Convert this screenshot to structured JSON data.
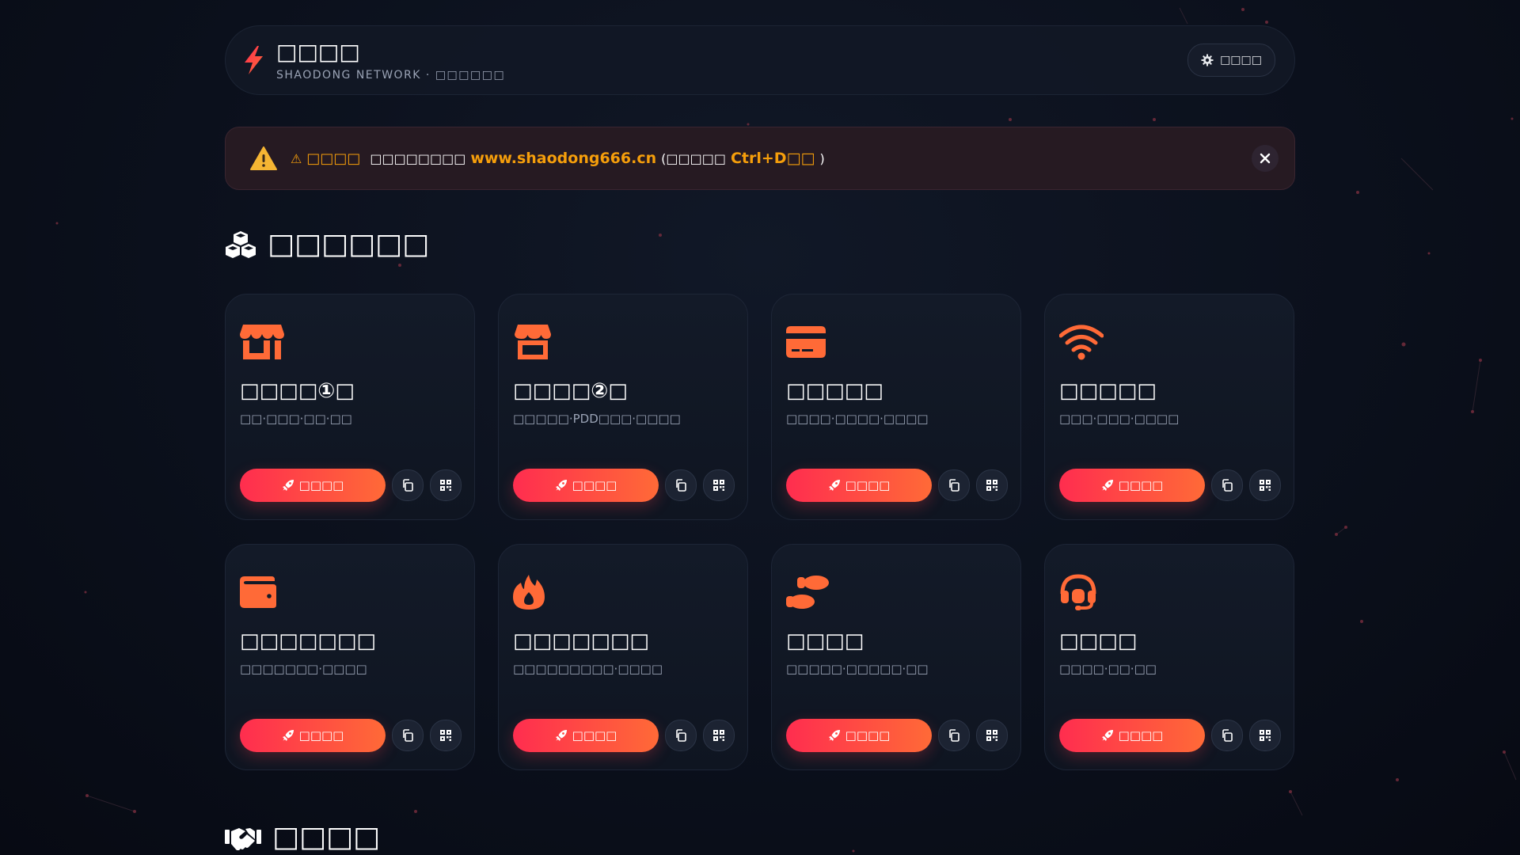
{
  "header": {
    "title": "□□□□",
    "subtitle": "SHAODONG NETWORK · □□□□□□",
    "settings_label": "□□□□"
  },
  "notice": {
    "label": "□□□□",
    "message": "□□□□□□□□",
    "url": "www.shaodong666.cn",
    "paren_open": "(□□□□□",
    "shortcut": "Ctrl+D□□",
    "paren_close": ")"
  },
  "sections": {
    "tools_title": "□□□□□□",
    "partners_title": "□□□□"
  },
  "cards": [
    {
      "icon": "store-icon",
      "title": "□□□□①□",
      "desc": "□□·□□□·□□·□□",
      "button": "□□□□"
    },
    {
      "icon": "shop-icon",
      "title": "□□□□②□",
      "desc": "□□□□□·PDD□□□·□□□□",
      "button": "□□□□"
    },
    {
      "icon": "credit-card-icon",
      "title": "□□□□□",
      "desc": "□□□□·□□□□·□□□□",
      "button": "□□□□"
    },
    {
      "icon": "wifi-icon",
      "title": "□□□□□",
      "desc": "□□□·□□□·□□□□",
      "button": "□□□□"
    },
    {
      "icon": "wallet-icon",
      "title": "□□□□□□□",
      "desc": "□□□□□□□·□□□□",
      "button": "□□□□"
    },
    {
      "icon": "fire-icon",
      "title": "□□□□□□□",
      "desc": "□□□□□□□□□·□□□□",
      "button": "□□□□"
    },
    {
      "icon": "shoe-prints-icon",
      "title": "□□□□",
      "desc": "□□□□□·□□□□□·□□",
      "button": "□□□□"
    },
    {
      "icon": "headset-icon",
      "title": "□□□□",
      "desc": "□□□□·□□·□□",
      "button": "□□□□"
    }
  ],
  "colors": {
    "accent_red": "#ff2d4f",
    "accent_orange": "#ff6a37",
    "warning": "#f59e0b"
  }
}
